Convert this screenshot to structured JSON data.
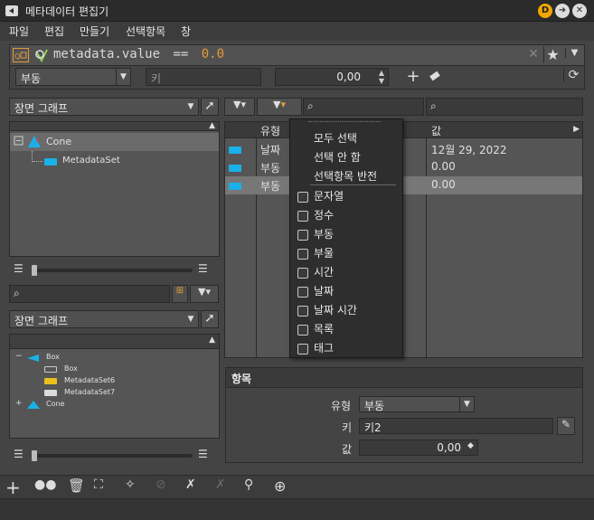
{
  "window": {
    "title": "메타데이터 편집기",
    "help_badge": "D"
  },
  "menu": [
    "파일",
    "편집",
    "만들기",
    "선택항목",
    "창"
  ],
  "expression": {
    "path": "metadata.value",
    "op": "==",
    "value": "0.0"
  },
  "filter_row": {
    "type_value": "부동",
    "key_placeholder": "키",
    "number_value": "0,00"
  },
  "left_top": {
    "graph_combo": "장면 그래프",
    "tree": [
      {
        "label": "Cone",
        "level": 0,
        "selected": true
      },
      {
        "label": "MetadataSet",
        "level": 1,
        "selected": false
      }
    ]
  },
  "left_bottom": {
    "graph_combo": "장면 그래프",
    "tree": [
      {
        "label": "Box",
        "level": 0
      },
      {
        "label": "Box",
        "level": 1
      },
      {
        "label": "MetadataSet6",
        "level": 1
      },
      {
        "label": "MetadataSet7",
        "level": 1
      },
      {
        "label": "Cone",
        "level": 0
      }
    ]
  },
  "table": {
    "col_type": "유형",
    "col_value": "값",
    "rows": [
      {
        "type": "날짜",
        "value": "12월 29, 2022",
        "selected": false
      },
      {
        "type": "부동",
        "value": "0.00",
        "selected": false
      },
      {
        "type": "부동",
        "value": "0.00",
        "selected": true
      }
    ]
  },
  "dropdown": {
    "actions": [
      "모두 선택",
      "선택 안 함",
      "선택항목 반전"
    ],
    "types": [
      "문자열",
      "정수",
      "부동",
      "부울",
      "시간",
      "날짜",
      "날짜 시간",
      "목록",
      "태그"
    ]
  },
  "properties": {
    "header": "항목",
    "type_label": "유형",
    "type_value": "부동",
    "key_label": "키",
    "key_value": "키2",
    "value_label": "값",
    "value_value": "0,00"
  },
  "icons": {
    "accent": "#e59a3a",
    "tag_color": "#1ab0e8",
    "help_color": "#f0a800"
  }
}
